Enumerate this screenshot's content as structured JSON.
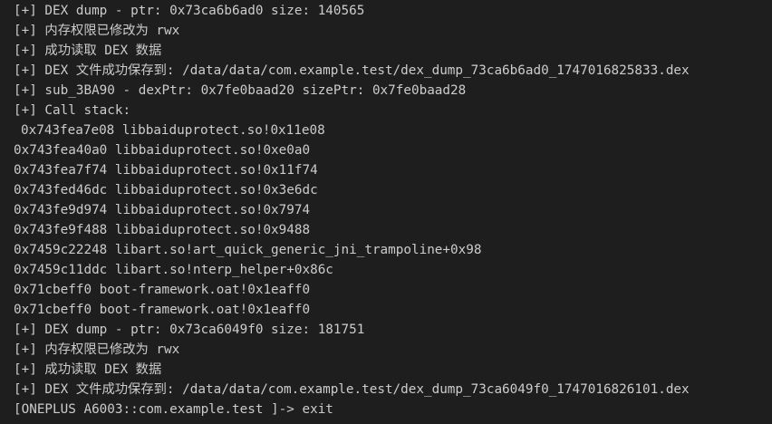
{
  "terminal": {
    "lines": [
      "[+] DEX dump - ptr: 0x73ca6b6ad0 size: 140565",
      "[+] 内存权限已修改为 rwx",
      "[+] 成功读取 DEX 数据",
      "[+] DEX 文件成功保存到: /data/data/com.example.test/dex_dump_73ca6b6ad0_1747016825833.dex",
      "[+] sub_3BA90 - dexPtr: 0x7fe0baad20 sizePtr: 0x7fe0baad28",
      "[+] Call stack:",
      "0x743fea7e08 libbaiduprotect.so!0x11e08",
      "0x743fea40a0 libbaiduprotect.so!0xe0a0",
      "0x743fea7f74 libbaiduprotect.so!0x11f74",
      "0x743fed46dc libbaiduprotect.so!0x3e6dc",
      "0x743fe9d974 libbaiduprotect.so!0x7974",
      "0x743fe9f488 libbaiduprotect.so!0x9488",
      "0x7459c22248 libart.so!art_quick_generic_jni_trampoline+0x98",
      "0x7459c11ddc libart.so!nterp_helper+0x86c",
      "0x71cbeff0 boot-framework.oat!0x1eaff0",
      "0x71cbeff0 boot-framework.oat!0x1eaff0",
      "[+] DEX dump - ptr: 0x73ca6049f0 size: 181751",
      "[+] 内存权限已修改为 rwx",
      "[+] 成功读取 DEX 数据",
      "[+] DEX 文件成功保存到: /data/data/com.example.test/dex_dump_73ca6049f0_1747016826101.dex",
      "[ONEPLUS A6003::com.example.test ]-> exit"
    ]
  }
}
